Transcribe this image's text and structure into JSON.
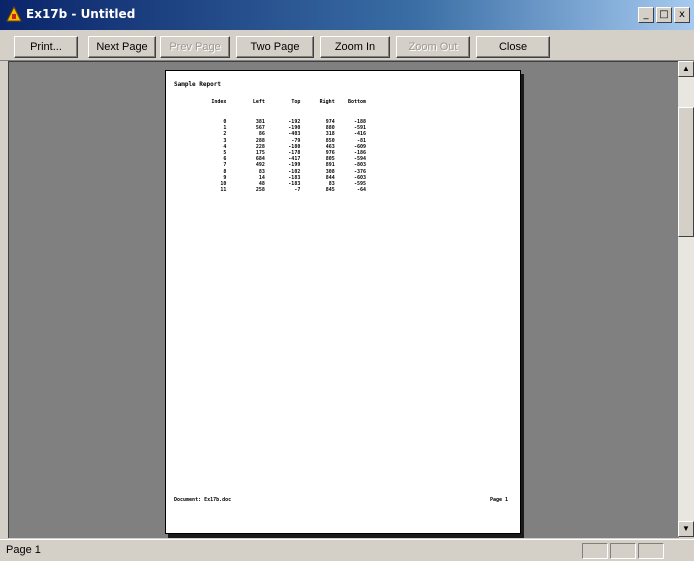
{
  "window": {
    "title": "Ex17b - Untitled",
    "controls": {
      "minimize": "_",
      "maximize": "□",
      "close": "x"
    }
  },
  "toolbar": {
    "print_label": "Print...",
    "next_page_label": "Next Page",
    "prev_page_label": "Prev Page",
    "two_page_label": "Two Page",
    "zoom_in_label": "Zoom In",
    "zoom_out_label": "Zoom Out",
    "close_label": "Close"
  },
  "report": {
    "title": "Sample Report",
    "columns": [
      "Index",
      "Left",
      "Top",
      "Right",
      "Bottom"
    ],
    "rows": [
      [
        "0",
        "381",
        "-192",
        "974",
        "-188"
      ],
      [
        "1",
        "567",
        "-190",
        "880",
        "-591"
      ],
      [
        "2",
        "86",
        "-403",
        "318",
        "-416"
      ],
      [
        "3",
        "288",
        "-79",
        "850",
        "-81"
      ],
      [
        "4",
        "228",
        "-180",
        "463",
        "-609"
      ],
      [
        "5",
        "175",
        "-178",
        "976",
        "-186"
      ],
      [
        "6",
        "684",
        "-417",
        "805",
        "-594"
      ],
      [
        "7",
        "492",
        "-199",
        "891",
        "-803"
      ],
      [
        "8",
        "83",
        "-102",
        "308",
        "-376"
      ],
      [
        "9",
        "14",
        "-183",
        "844",
        "-603"
      ],
      [
        "10",
        "48",
        "-183",
        "83",
        "-595"
      ],
      [
        "11",
        "258",
        "-7",
        "845",
        "-64"
      ]
    ],
    "footer_left": "Document: Ex17b.doc",
    "footer_right": "Page 1"
  },
  "statusbar": {
    "text": "Page 1"
  },
  "icons": {
    "app": "app-icon",
    "scroll_up": "scroll-up-arrow-icon",
    "scroll_down": "scroll-down-arrow-icon"
  }
}
